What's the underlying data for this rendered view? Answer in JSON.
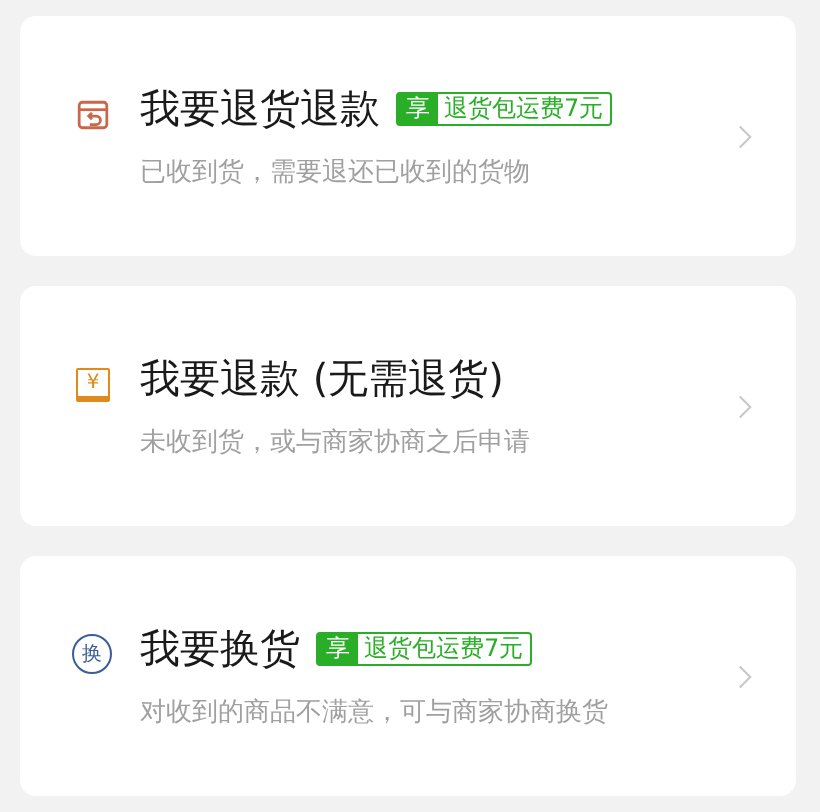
{
  "options": [
    {
      "kind": "return",
      "title": "我要退货退款",
      "badge": {
        "mark": "享",
        "text": "退货包运费7元"
      },
      "description": "已收到货，需要退还已收到的货物"
    },
    {
      "kind": "refund",
      "icon_text": "¥",
      "title": "我要退款 (无需退货)",
      "description": "未收到货，或与商家协商之后申请"
    },
    {
      "kind": "exchange",
      "icon_text": "换",
      "title": "我要换货",
      "badge": {
        "mark": "享",
        "text": "退货包运费7元"
      },
      "description": "对收到的商品不满意，可与商家协商换货"
    }
  ]
}
